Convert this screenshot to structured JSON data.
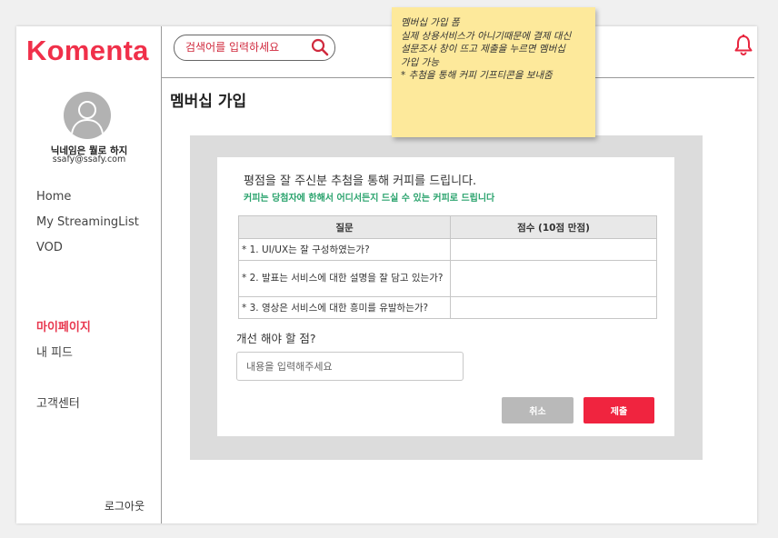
{
  "app": {
    "logo": "Komenta"
  },
  "profile": {
    "nickname": "닉네임은 뭘로 하지",
    "email": "ssafy@ssafy.com"
  },
  "search": {
    "placeholder": "검색어를 입력하세요"
  },
  "nav": {
    "items": [
      {
        "label": "Home"
      },
      {
        "label": "My StreamingList"
      },
      {
        "label": "VOD"
      },
      {
        "label": "마이페이지",
        "active": true
      },
      {
        "label": "내 피드"
      },
      {
        "label": "고객센터"
      }
    ],
    "logout": "로그아웃"
  },
  "page": {
    "title": "멤버십 가입"
  },
  "sticky_note": {
    "lines": [
      "멤버십 가입 폼",
      "실제 상용서비스가 아니기때문에 결제 대신",
      "설문조사 창이 뜨고 제출을 누르면 멤버십",
      "가입 가능",
      "* 추첨을 통해 커피 기프티콘을 보내줌"
    ]
  },
  "survey": {
    "heading": "평점을 잘 주신분 추첨을 통해 커피를 드립니다.",
    "subheading": "커피는 당첨자에 한해서 어디서든지 드실 수 있는 커피로 드립니다",
    "columns": [
      "질문",
      "점수 (10점 만점)"
    ],
    "questions": [
      "* 1. UI/UX는 잘 구성하였는가?",
      " * 2. 발표는 서비스에 대한 설명을 잘 담고 있는가?",
      "* 3. 영상은 서비스에 대한 흥미를 유발하는가?"
    ],
    "improve_label": "개선 해야 할 점?",
    "improve_placeholder": "내용을 입력해주세요",
    "cancel_label": "취소",
    "submit_label": "제출"
  },
  "colors": {
    "brand": "#f0304a",
    "submit": "#f0243f",
    "cancel": "#b9b9b9",
    "sticky": "#fde99b",
    "note_green": "#2aa36d"
  },
  "icons": {
    "search": "search-icon",
    "bell": "bell-icon",
    "avatar": "user-avatar-icon"
  }
}
